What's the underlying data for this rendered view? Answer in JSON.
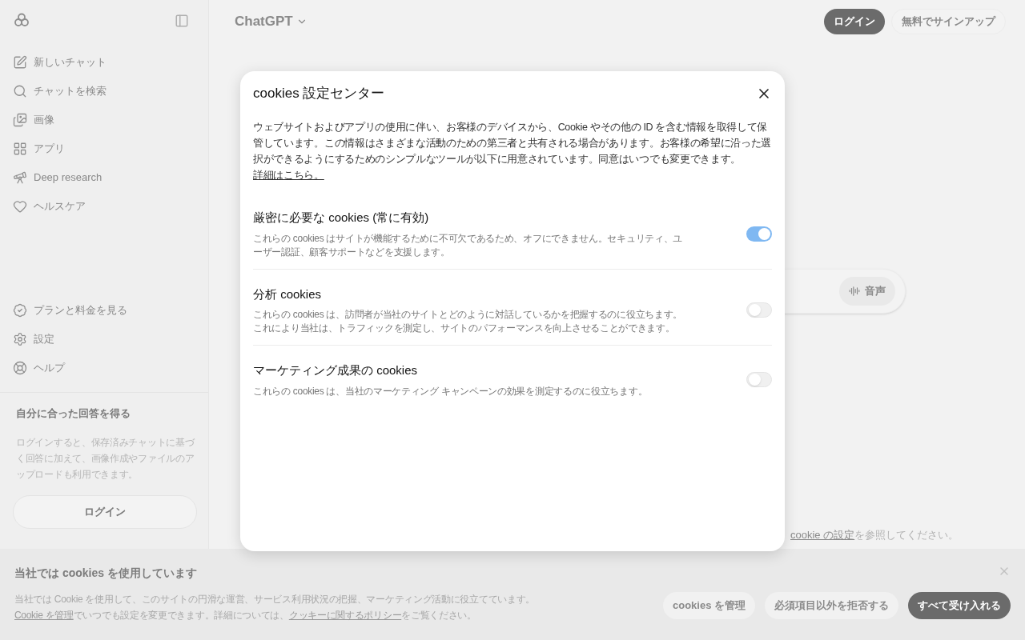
{
  "sidebar": {
    "nav": [
      {
        "label": "新しいチャット"
      },
      {
        "label": "チャットを検索"
      },
      {
        "label": "画像"
      },
      {
        "label": "アプリ"
      },
      {
        "label": "Deep research"
      },
      {
        "label": "ヘルスケア"
      }
    ],
    "footer_nav": [
      {
        "label": "プランと料金を見る"
      },
      {
        "label": "設定"
      },
      {
        "label": "ヘルプ"
      }
    ],
    "promo": {
      "title": "自分に合った回答を得る",
      "text": "ログインすると、保存済みチャットに基づく回答に加えて、画像作成やファイルのアップロードも利用できます。",
      "button": "ログイン"
    }
  },
  "header": {
    "title": "ChatGPT",
    "login": "ログイン",
    "signup": "無料でサインアップ"
  },
  "composer": {
    "voice_button": "音声"
  },
  "footer_notice": {
    "link": "cookie の設定",
    "text": "を参照してください。"
  },
  "banner": {
    "title": "当社では cookies を使用しています",
    "segments": [
      {
        "kind": "text",
        "text": "当社では Cookie を使用して、このサイトの円滑な運営、サービス利用状況の把握、マーケティング活動に役立てています。"
      },
      {
        "kind": "link",
        "text": "Cookie を管理"
      },
      {
        "kind": "text",
        "text": "でいつでも設定を変更できます。詳細については、"
      },
      {
        "kind": "link",
        "text": "クッキーに関するポリシー"
      },
      {
        "kind": "text",
        "text": "をご覧ください。"
      }
    ],
    "buttons": [
      {
        "label": "cookies を管理",
        "kind": "secondary"
      },
      {
        "label": "必須項目以外を拒否する",
        "kind": "secondary"
      },
      {
        "label": "すべて受け入れる",
        "kind": "primary"
      }
    ]
  },
  "modal": {
    "title": "cookies 設定センター",
    "intro": "ウェブサイトおよびアプリの使用に伴い、お客様のデバイスから、Cookie やその他の ID を含む情報を取得して保管しています。この情報はさまざまな活動のための第三者と共有される場合があります。お客様の希望に沿った選択ができるようにするためのシンプルなツールが以下に用意されています。同意はいつでも変更できます。",
    "intro_link": "詳細はこちら。",
    "categories": [
      {
        "title": "厳密に必要な cookies (常に有効)",
        "description": "これらの cookies はサイトが機能するために不可欠であるため、オフにできません。セキュリティ、ユーザー認証、顧客サポートなどを支援します。",
        "on": true
      },
      {
        "title": "分析 cookies",
        "description": "これらの cookies は、訪問者が当社のサイトとどのように対話しているかを把握するのに役立ちます。これにより当社は、トラフィックを測定し、サイトのパフォーマンスを向上させることができます。",
        "on": false
      },
      {
        "title": "マーケティング成果の cookies",
        "description": "これらの cookies は、当社のマーケティング キャンペーンの効果を測定するのに役立ちます。",
        "on": false
      }
    ]
  }
}
